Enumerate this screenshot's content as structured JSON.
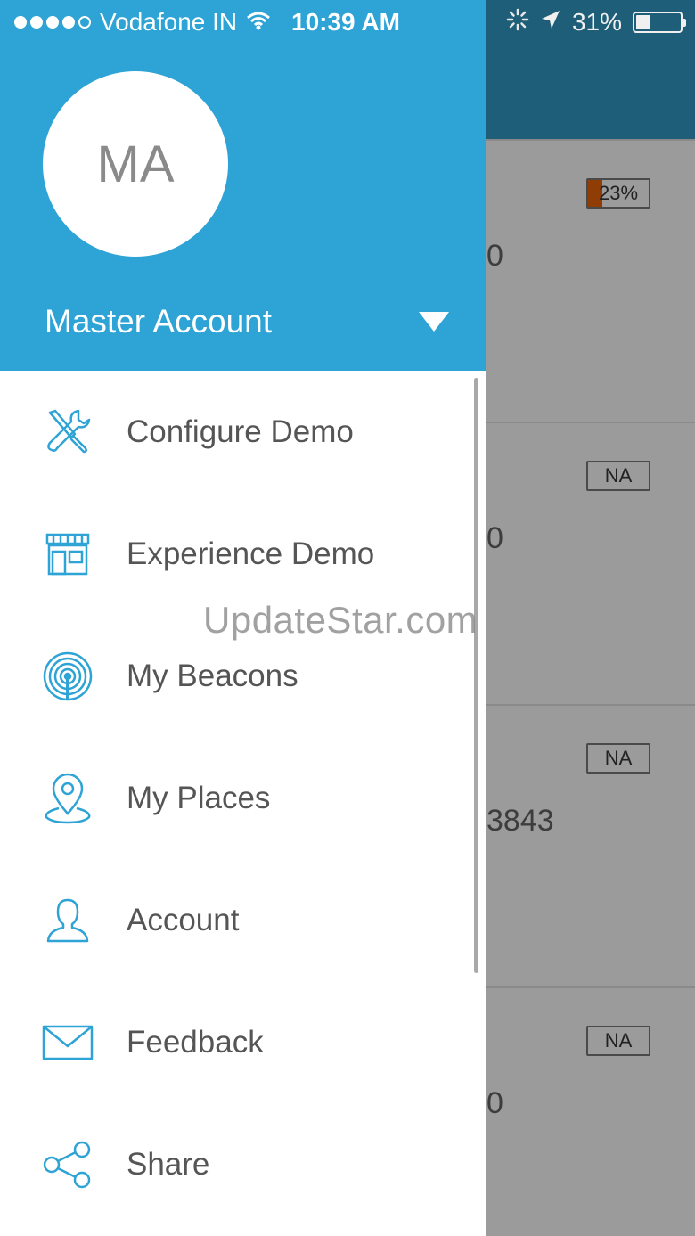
{
  "status_bar": {
    "carrier": "Vodafone IN",
    "time": "10:39 AM",
    "battery": "31%",
    "battery_level": 0.31,
    "icons": [
      "signal-icon",
      "wifi-icon",
      "activity-spinner-icon",
      "location-arrow-icon",
      "battery-icon"
    ]
  },
  "drawer": {
    "avatar_initials": "MA",
    "account_name": "Master Account",
    "menu": [
      {
        "label": "Configure Demo",
        "icon": "tools-icon"
      },
      {
        "label": "Experience Demo",
        "icon": "storefront-icon"
      },
      {
        "label": "My Beacons",
        "icon": "beacon-icon"
      },
      {
        "label": "My Places",
        "icon": "map-pin-icon"
      },
      {
        "label": "Account",
        "icon": "user-icon"
      },
      {
        "label": "Feedback",
        "icon": "envelope-icon"
      },
      {
        "label": "Share",
        "icon": "share-icon"
      }
    ]
  },
  "background_list": {
    "rows": [
      {
        "battery": "23%",
        "battery_level": 0.23,
        "partial_text": "0"
      },
      {
        "battery": "NA",
        "partial_text": "0"
      },
      {
        "battery": "NA",
        "partial_text": "3843"
      },
      {
        "battery": "NA",
        "partial_text": "0"
      }
    ]
  },
  "watermark": "UpdateStar.com",
  "colors": {
    "drawer_header": "#2ea3d5",
    "icon_accent": "#2ea3d5",
    "background_header": "#1f5e78",
    "overlay_gray": "#9b9b9b",
    "battery_low": "#8f3d05"
  }
}
